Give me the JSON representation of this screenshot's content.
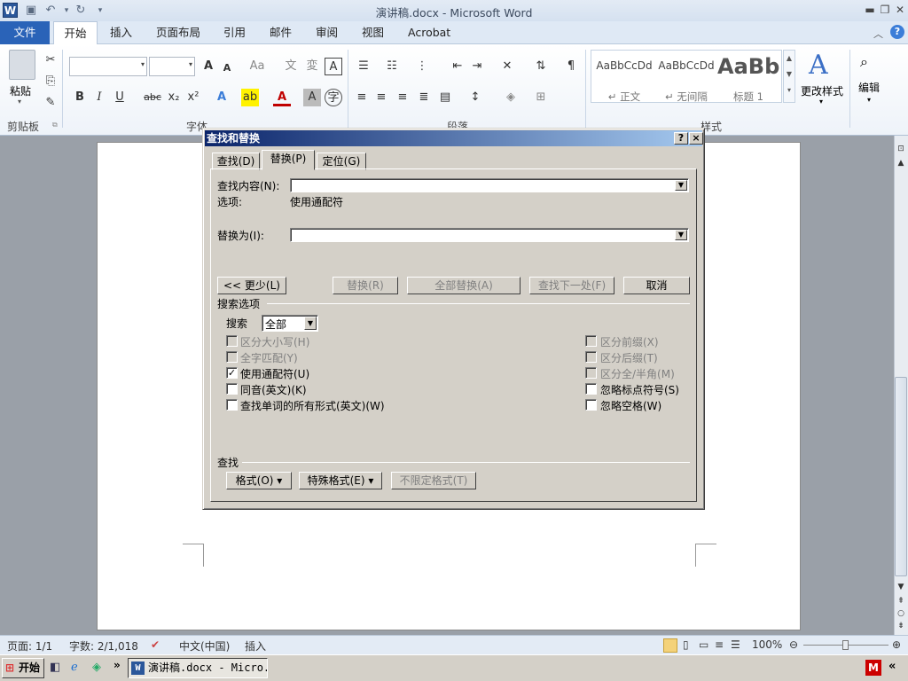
{
  "window": {
    "title": "演讲稿.docx - Microsoft Word",
    "app_icon": "W"
  },
  "quick_access": {
    "save_icon": "save-icon",
    "undo_icon": "undo-icon",
    "redo_icon": "redo-icon"
  },
  "ribbon": {
    "tabs": [
      {
        "label": "文件"
      },
      {
        "label": "开始"
      },
      {
        "label": "插入"
      },
      {
        "label": "页面布局"
      },
      {
        "label": "引用"
      },
      {
        "label": "邮件"
      },
      {
        "label": "审阅"
      },
      {
        "label": "视图"
      },
      {
        "label": "Acrobat"
      }
    ],
    "clipboard": {
      "paste_label": "粘贴",
      "group_label": "剪贴板"
    },
    "font": {
      "group_label": "字体",
      "grow": "A",
      "shrink": "A",
      "aa": "Aa",
      "bold": "B",
      "italic": "I",
      "underline": "U",
      "strike": "abc",
      "sub": "x₂",
      "sup": "x²"
    },
    "paragraph": {
      "group_label": "段落"
    },
    "styles": {
      "group_label": "样式",
      "items": [
        {
          "preview": "AaBbCcDd",
          "name": "↵ 正文"
        },
        {
          "preview": "AaBbCcDd",
          "name": "↵ 无间隔"
        },
        {
          "preview": "AaBb",
          "name": "标题 1"
        }
      ],
      "change_styles": "更改样式"
    },
    "edit": {
      "label": "编辑"
    }
  },
  "dialog": {
    "title": "查找和替换",
    "help": "?",
    "close": "×",
    "tabs": [
      {
        "label": "查找(D)"
      },
      {
        "label": "替换(P)"
      },
      {
        "label": "定位(G)"
      }
    ],
    "find_label": "查找内容(N):",
    "find_value": "",
    "options_label": "选项:",
    "options_value": "使用通配符",
    "replace_label": "替换为(I):",
    "replace_value": "",
    "buttons": {
      "less": "<< 更少(L)",
      "replace": "替换(R)",
      "replace_all": "全部替换(A)",
      "find_next": "查找下一处(F)",
      "cancel": "取消"
    },
    "search_options": {
      "title": "搜索选项",
      "search_label": "搜索",
      "search_value": "全部",
      "left": [
        {
          "label": "区分大小写(H)",
          "checked": false,
          "disabled": true
        },
        {
          "label": "全字匹配(Y)",
          "checked": false,
          "disabled": true
        },
        {
          "label": "使用通配符(U)",
          "checked": true,
          "disabled": false
        },
        {
          "label": "同音(英文)(K)",
          "checked": false,
          "disabled": false
        },
        {
          "label": "查找单词的所有形式(英文)(W)",
          "checked": false,
          "disabled": false
        }
      ],
      "right": [
        {
          "label": "区分前缀(X)",
          "checked": false,
          "disabled": true
        },
        {
          "label": "区分后缀(T)",
          "checked": false,
          "disabled": true
        },
        {
          "label": "区分全/半角(M)",
          "checked": false,
          "disabled": true
        },
        {
          "label": "忽略标点符号(S)",
          "checked": false,
          "disabled": false
        },
        {
          "label": "忽略空格(W)",
          "checked": false,
          "disabled": false
        }
      ]
    },
    "find_section": {
      "title": "查找",
      "format": "格式(O) ▾",
      "special": "特殊格式(E) ▾",
      "no_format": "不限定格式(T)"
    }
  },
  "status": {
    "page": "页面: 1/1",
    "words": "字数: 2/1,018",
    "language": "中文(中国)",
    "mode": "插入",
    "zoom": "100%"
  },
  "taskbar": {
    "start": "开始",
    "task": "演讲稿.docx - Micro..."
  },
  "colors": {
    "file_tab": "#2a63b8",
    "dialog_title_start": "#0a246a",
    "dialog_title_end": "#a6caf0"
  }
}
